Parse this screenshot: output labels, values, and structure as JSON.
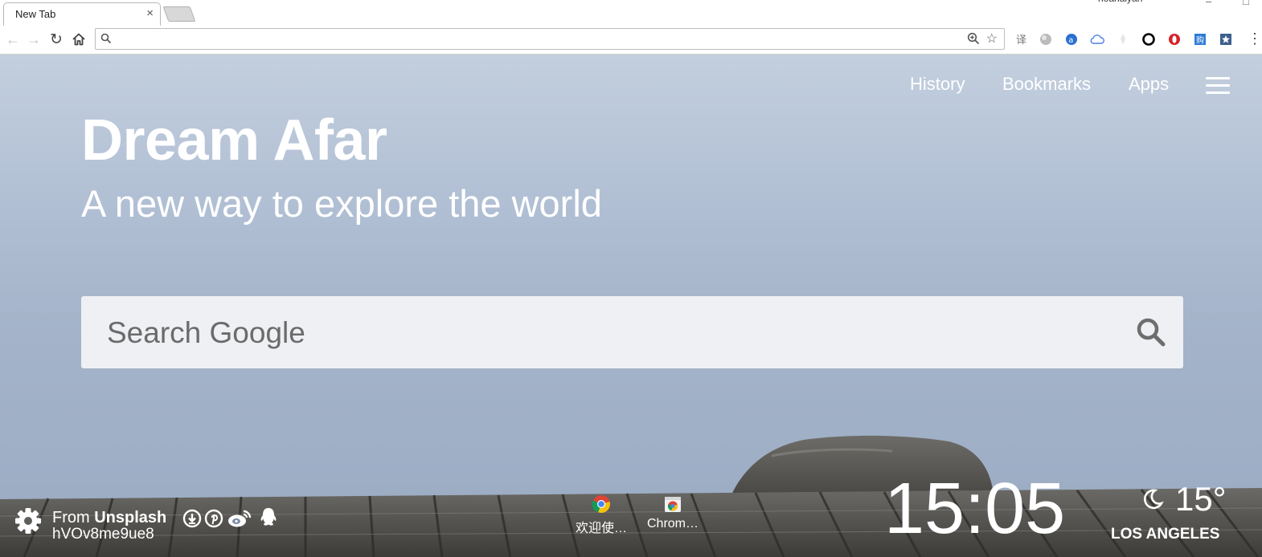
{
  "tab": {
    "title": "New Tab",
    "close": "×"
  },
  "window": {
    "profile": "noahaiyan",
    "minimize": "–",
    "maximize": "□"
  },
  "toolbar": {
    "back": "←",
    "forward": "→",
    "reload": "↻",
    "omnibox_value": "",
    "star": "☆",
    "menu": "⋮",
    "extensions": [
      "translate-icon",
      "globe-extension-icon",
      "a-extension-icon",
      "cloud-extension-icon",
      "pin-extension-icon",
      "circle-extension-icon",
      "opera-extension-icon",
      "shop-extension-icon",
      "star-extension-icon"
    ]
  },
  "nav": {
    "history": "History",
    "bookmarks": "Bookmarks",
    "apps": "Apps"
  },
  "hero": {
    "title": "Dream Afar",
    "subtitle": "A new way to explore the world"
  },
  "search": {
    "placeholder": "Search Google",
    "value": ""
  },
  "credit": {
    "from": "From ",
    "source": "Unsplash",
    "photo_id": "hVOv8me9ue8"
  },
  "social": [
    "download-icon",
    "pinterest-icon",
    "weibo-icon",
    "qq-icon"
  ],
  "shortcuts": [
    {
      "label": "欢迎使…",
      "icon": "chrome-icon"
    },
    {
      "label": "Chrom…",
      "icon": "chrome-webstore-icon"
    }
  ],
  "clock": {
    "time": "15:05"
  },
  "weather": {
    "temperature": "15°",
    "city": "LOS ANGELES",
    "icon": "moon-icon"
  },
  "colors": {
    "sky": "#b1bfd4",
    "search_bg": "#f3f3f5",
    "text": "#ffffff"
  }
}
